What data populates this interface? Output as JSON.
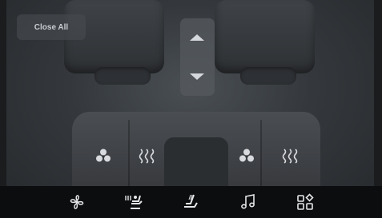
{
  "buttons": {
    "close_all": "Close All"
  },
  "scroll": {
    "up_icon": "chevron-up-icon",
    "down_icon": "chevron-down-icon"
  },
  "seat_controls": [
    {
      "seat": "rear-left",
      "icon": "fan-icon"
    },
    {
      "seat": "rear-left",
      "icon": "seat-heat-icon"
    },
    {
      "seat": "rear-right",
      "icon": "fan-icon"
    },
    {
      "seat": "rear-right",
      "icon": "seat-heat-icon"
    }
  ],
  "nav": {
    "items": [
      {
        "icon": "fan-icon"
      },
      {
        "icon": "seat-ventilation-icon"
      },
      {
        "icon": "seat-recline-icon"
      },
      {
        "icon": "music-note-icon"
      },
      {
        "icon": "apps-grid-icon"
      }
    ]
  },
  "colors": {
    "icon": "#d8dade",
    "nav_bg": "#0c0d0e"
  }
}
